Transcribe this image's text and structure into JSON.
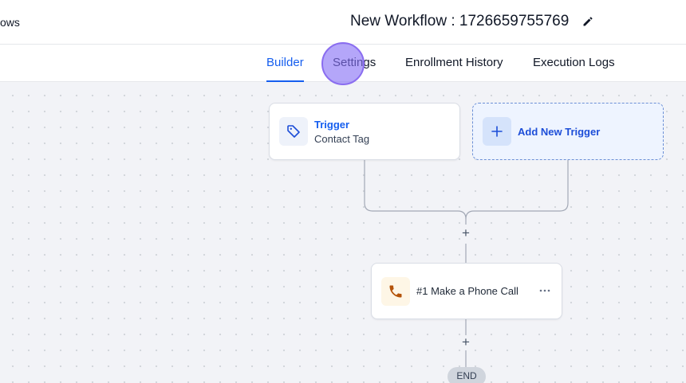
{
  "header": {
    "breadcrumb": "ows",
    "title": "New Workflow : 1726659755769",
    "edit_icon": "pencil-icon"
  },
  "tabs": [
    {
      "label": "Builder",
      "active": true
    },
    {
      "label": "Settings",
      "active": false
    },
    {
      "label": "Enrollment History",
      "active": false
    },
    {
      "label": "Execution Logs",
      "active": false
    }
  ],
  "builder": {
    "trigger": {
      "label": "Trigger",
      "subtitle": "Contact Tag",
      "icon": "tag-icon"
    },
    "add_trigger": {
      "label": "Add New Trigger",
      "icon": "plus-icon"
    },
    "add_step_symbol": "+",
    "actions": [
      {
        "label": "#1 Make a Phone Call",
        "icon": "phone-icon"
      }
    ],
    "end_label": "END"
  },
  "colors": {
    "accent": "#155eef",
    "phone": "#b45309",
    "cursor_highlight": "#8a6df0"
  }
}
